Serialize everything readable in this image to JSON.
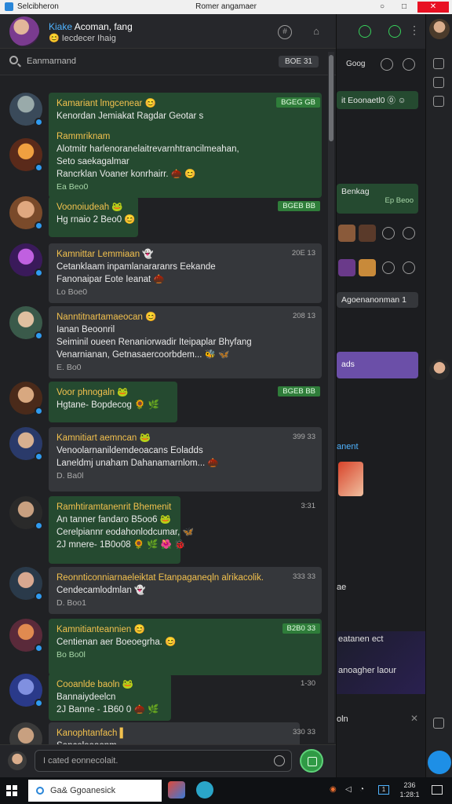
{
  "window": {
    "app_name": "Selcibheron",
    "title": "Romer angamaer",
    "controls": [
      "○",
      "□",
      "✕"
    ]
  },
  "chat_header": {
    "title_highlight": "Kiake",
    "title_rest": " Acoman, fang",
    "subtitle": "😊 Iecdecer Ihaig"
  },
  "search": {
    "placeholder": "Eanmarnand",
    "count": "BOE 31"
  },
  "messages": [
    {
      "name": "Kamariant lmgcenear 😊",
      "lines": [
        "Kenordan Jemiakat Ragdar Geotar s"
      ],
      "foot": "",
      "tag": "BGEG GB",
      "tag_kind": "g",
      "bubble": "g"
    },
    {
      "name": "Rammriknam",
      "lines": [
        "Alotmitr harlenoranelaitrevarnhtrancilmeahan,",
        "Seto saekagalmar",
        "Rancrklan Voaner konrhairr. 🌰 😊"
      ],
      "foot": "Ea Beo0",
      "tag": "",
      "tag_kind": "",
      "bubble": "g"
    },
    {
      "name": "Voonoiudeah 🐸",
      "lines": [
        "Hg rnaio 2 Beo0 😊"
      ],
      "foot": "",
      "tag": "BGEB BB",
      "tag_kind": "g",
      "bubble": "g"
    },
    {
      "name": "Kamnittar Lemmiaan 👻",
      "lines": [
        "Cetanklaam inpamlanararanrs Eekande",
        "Fanonaipar Eote Ieanat 🌰"
      ],
      "foot": "Lo Boe0",
      "tag": "20E 13",
      "tag_kind": "t",
      "bubble": "d"
    },
    {
      "name": "Nanntitnartamaeocan 😊",
      "lines": [
        "Ianan Beoonril",
        "Seiminil oueen Renaniorwadir Iteipaplar Bhyfang",
        "Venarnianan, Getnasaercoorbdem... 🐝 🦋"
      ],
      "foot": "E. Bo0",
      "tag": "208 13",
      "tag_kind": "t",
      "bubble": "d"
    },
    {
      "name": "Voor phnogaln 🐸",
      "lines": [
        "Hgtane- Bopdecog 🌻 🌿"
      ],
      "foot": "",
      "tag": "BGEB BB",
      "tag_kind": "g",
      "bubble": "g"
    },
    {
      "name": "Kamnitiart aemncan 🐸",
      "lines": [
        "Venoolarnanildemdeoacans Eoladds",
        "Laneldmj unaham Dahanamarnlom... 🌰"
      ],
      "foot": "D. Ba0l",
      "tag": "399 33",
      "tag_kind": "t",
      "bubble": "d"
    },
    {
      "name": "Ramhtiramtanenrit Bhemenit",
      "lines": [
        "An tanner fandaro B5oo6 🐸",
        "Cerelpiannr eodahonlodcumar, 🦋",
        "2J mnere- 1B0o08 🌻 🌿 🌺 🐞"
      ],
      "foot": "",
      "tag": "3:31",
      "tag_kind": "t",
      "bubble": "g"
    },
    {
      "name": "Reonnticonniarnaeleiktat Etanpaganeqln alrikacolik.",
      "lines": [
        "Cendecamlodmlan 👻"
      ],
      "foot": "D. Boo1",
      "tag": "333 33",
      "tag_kind": "t",
      "bubble": "d"
    },
    {
      "name": "Kamnitianteannien 😊",
      "lines": [
        "Centienan aer Boeoegrha. 😊"
      ],
      "foot": "Bo Bo0l",
      "tag": "B2B0 33",
      "tag_kind": "g",
      "bubble": "g"
    },
    {
      "name": "Cooanlde baoln 🐸",
      "lines": [
        "Bannaiydeelcn",
        "2J Banne - 1B60 0 🌰 🌿"
      ],
      "foot": "",
      "tag": "1-30",
      "tag_kind": "t",
      "bubble": "g"
    },
    {
      "name": "Kanophtanfach ▌",
      "lines": [
        "Sencolooaonm"
      ],
      "foot": "",
      "tag": "330 33",
      "tag_kind": "t",
      "bubble": "d"
    }
  ],
  "compose": {
    "placeholder": "I cated eonnecolait."
  },
  "side_pane": {
    "header_text": "Goog",
    "b1": "it Eoonaetl0  ⓪ ☺",
    "b2a": "Benkag",
    "b2b": "Ep Beoo",
    "b3": "Agoenanonman 1",
    "b4": "ads",
    "b5": "anent",
    "p1": "ae",
    "p2": "eatanen ect",
    "p3": "anoagher laour",
    "p4": "oln"
  },
  "taskbar": {
    "search_text": "Ga& Ggoanesick",
    "clock_top": "236",
    "clock_bottom": "1:28:1"
  }
}
